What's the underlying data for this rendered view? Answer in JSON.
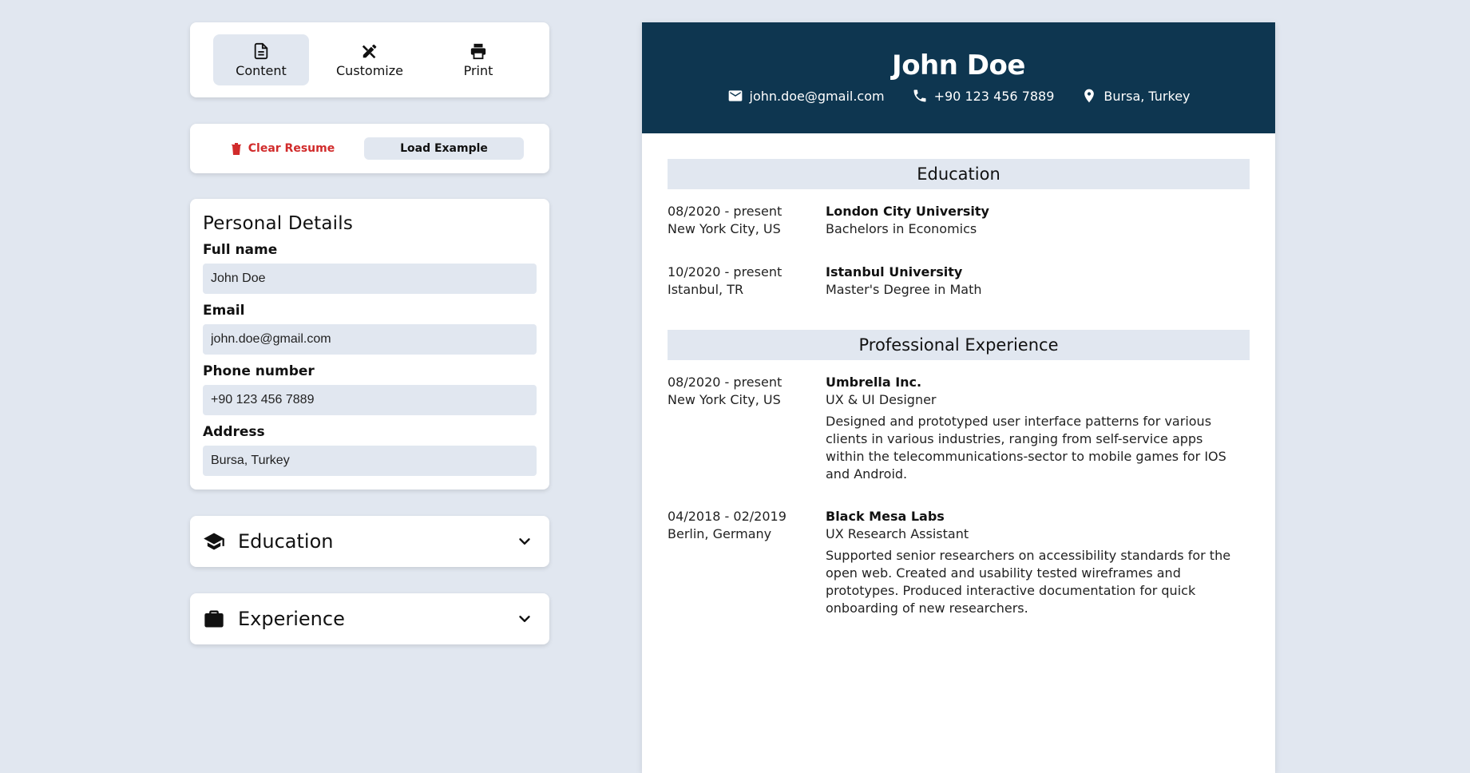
{
  "tabs": [
    {
      "label": "Content",
      "icon": "document-icon",
      "active": true
    },
    {
      "label": "Customize",
      "icon": "design-tools-icon",
      "active": false
    },
    {
      "label": "Print",
      "icon": "printer-icon",
      "active": false
    }
  ],
  "actions": {
    "clear_label": "Clear Resume",
    "load_label": "Load Example"
  },
  "personal": {
    "title": "Personal Details",
    "fields": [
      {
        "label": "Full name",
        "value": "John Doe"
      },
      {
        "label": "Email",
        "value": "john.doe@gmail.com"
      },
      {
        "label": "Phone number",
        "value": "+90 123 456 7889"
      },
      {
        "label": "Address",
        "value": "Bursa, Turkey"
      }
    ]
  },
  "sections": {
    "education": {
      "title": "Education",
      "icon": "graduation-cap-icon"
    },
    "experience": {
      "title": "Experience",
      "icon": "briefcase-icon"
    }
  },
  "resume": {
    "name": "John Doe",
    "email": "john.doe@gmail.com",
    "phone": "+90 123 456 7889",
    "address": "Bursa, Turkey",
    "header_color": "#0e3650",
    "education_title": "Education",
    "education": [
      {
        "date": "08/2020 - present",
        "location": "New York City, US",
        "org": "London City University",
        "role": "Bachelors in Economics"
      },
      {
        "date": "10/2020 - present",
        "location": "Istanbul, TR",
        "org": "Istanbul University",
        "role": "Master's Degree in Math"
      }
    ],
    "experience_title": "Professional Experience",
    "experience": [
      {
        "date": "08/2020 - present",
        "location": "New York City, US",
        "org": "Umbrella Inc.",
        "role": "UX & UI Designer",
        "desc": "Designed and prototyped user interface patterns for various clients in various industries, ranging from self-service apps within the telecommunications-sector to mobile games for IOS and Android."
      },
      {
        "date": "04/2018 - 02/2019",
        "location": "Berlin, Germany",
        "org": "Black Mesa Labs",
        "role": "UX Research Assistant",
        "desc": "Supported senior researchers on accessibility standards for the open web. Created and usability tested wireframes and prototypes. Produced interactive documentation for quick onboarding of new researchers."
      }
    ]
  },
  "colors": {
    "background": "#e1e7f0",
    "danger": "#d12b2b"
  }
}
